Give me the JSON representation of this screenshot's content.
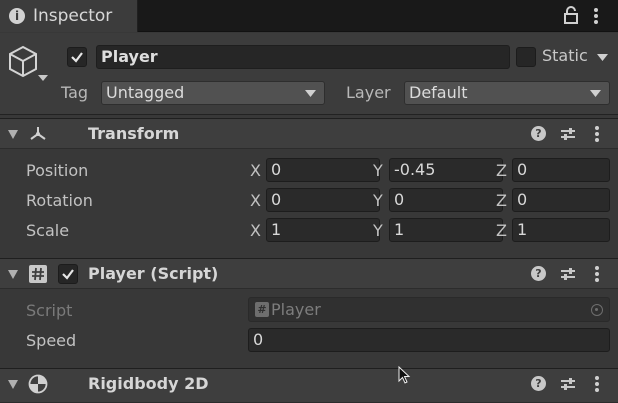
{
  "tab": {
    "title": "Inspector",
    "info_icon": "info-icon",
    "lock_icon": "lock-icon",
    "menu_icon": "kebab-menu-icon"
  },
  "gameobject": {
    "active": true,
    "name": "Player",
    "static_label": "Static",
    "tag_label": "Tag",
    "tag_value": "Untagged",
    "layer_label": "Layer",
    "layer_value": "Default"
  },
  "transform": {
    "title": "Transform",
    "position_label": "Position",
    "rotation_label": "Rotation",
    "scale_label": "Scale",
    "axis_x": "X",
    "axis_y": "Y",
    "axis_z": "Z",
    "position": {
      "x": "0",
      "y": "-0.45",
      "z": "0"
    },
    "rotation": {
      "x": "0",
      "y": "0",
      "z": "0"
    },
    "scale": {
      "x": "1",
      "y": "1",
      "z": "1"
    }
  },
  "player_script": {
    "title": "Player (Script)",
    "enabled": true,
    "script_label": "Script",
    "script_value": "Player",
    "speed_label": "Speed",
    "speed_value": "0"
  },
  "rigidbody": {
    "title": "Rigidbody 2D"
  },
  "colors": {
    "background": "#383838",
    "field": "#2a2a2a",
    "header": "#3e3e3e",
    "text": "#c4c4c4"
  }
}
